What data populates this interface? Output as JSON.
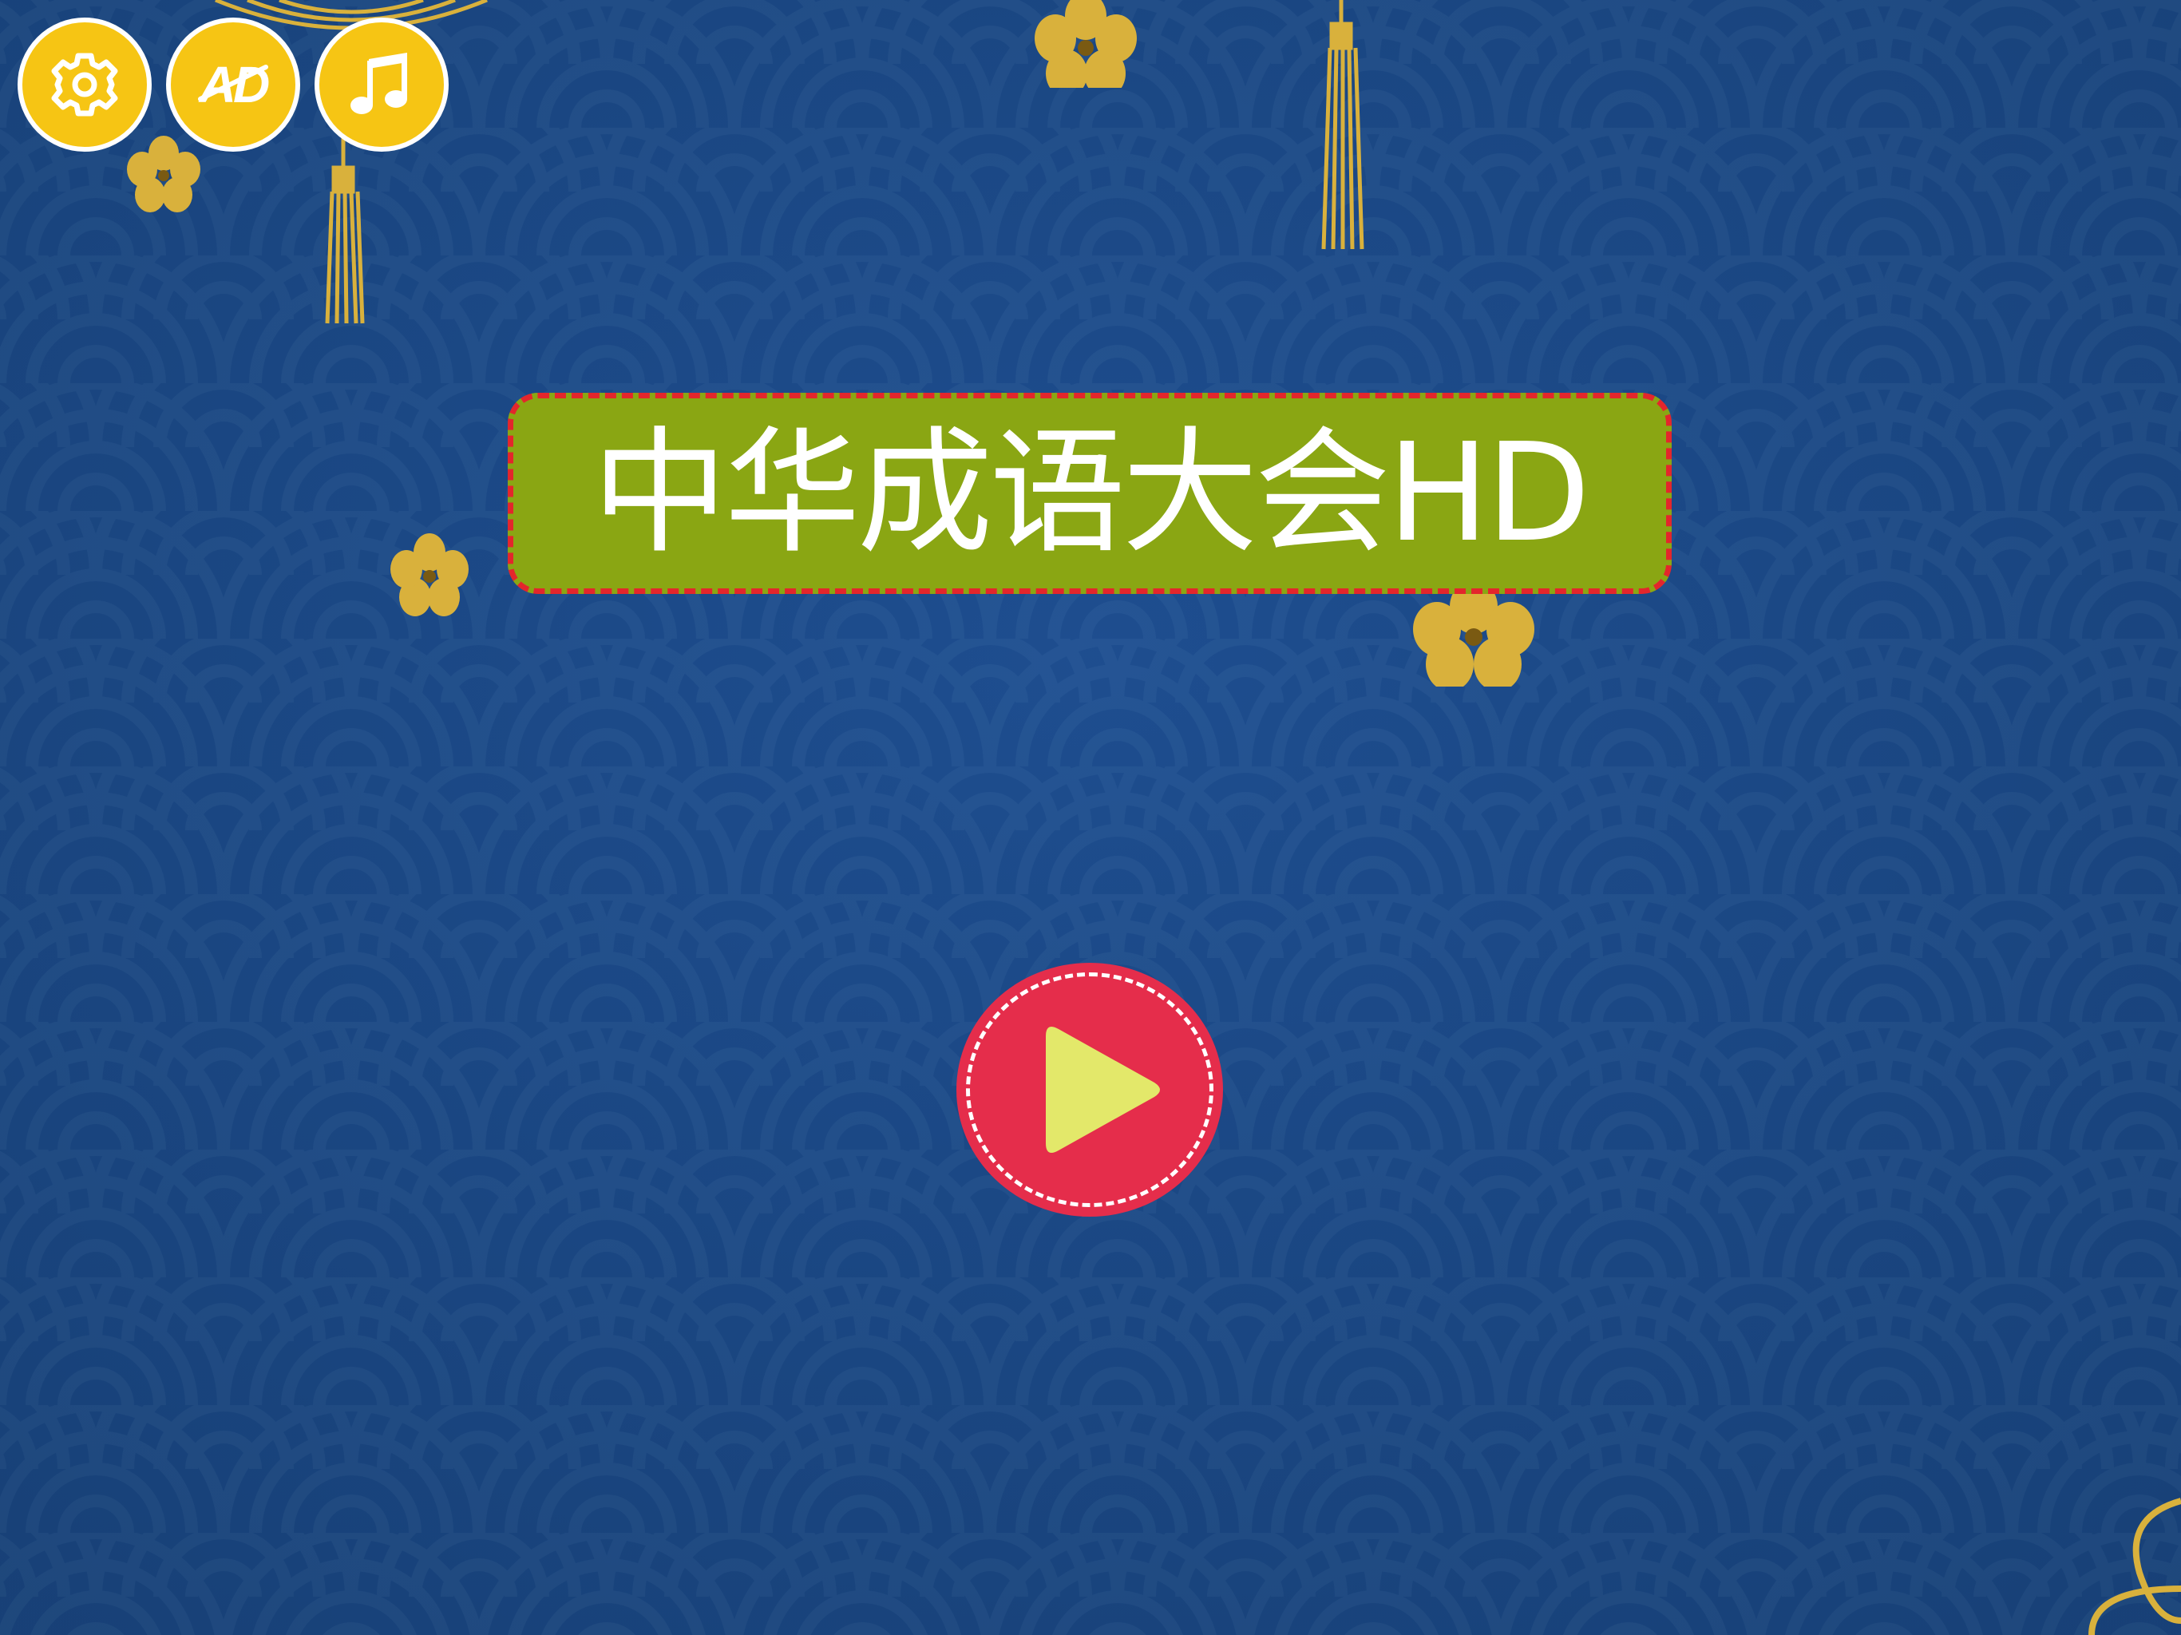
{
  "app": {
    "title": "中华成语大会HD"
  },
  "toolbar": {
    "settings_icon": "gear-icon",
    "ad_label": "AD",
    "ad_icon": "no-ads-icon",
    "music_icon": "music-note-icon"
  },
  "play": {
    "icon": "play-icon"
  },
  "colors": {
    "background": "#1c4a86",
    "pattern_stroke": "#244f86",
    "toolbar_button": "#f6c514",
    "banner": "#8aa613",
    "banner_border": "#e3262c",
    "play_button": "#e52d4b",
    "play_triangle": "#e3e86a",
    "gold": "#d9b13c"
  }
}
